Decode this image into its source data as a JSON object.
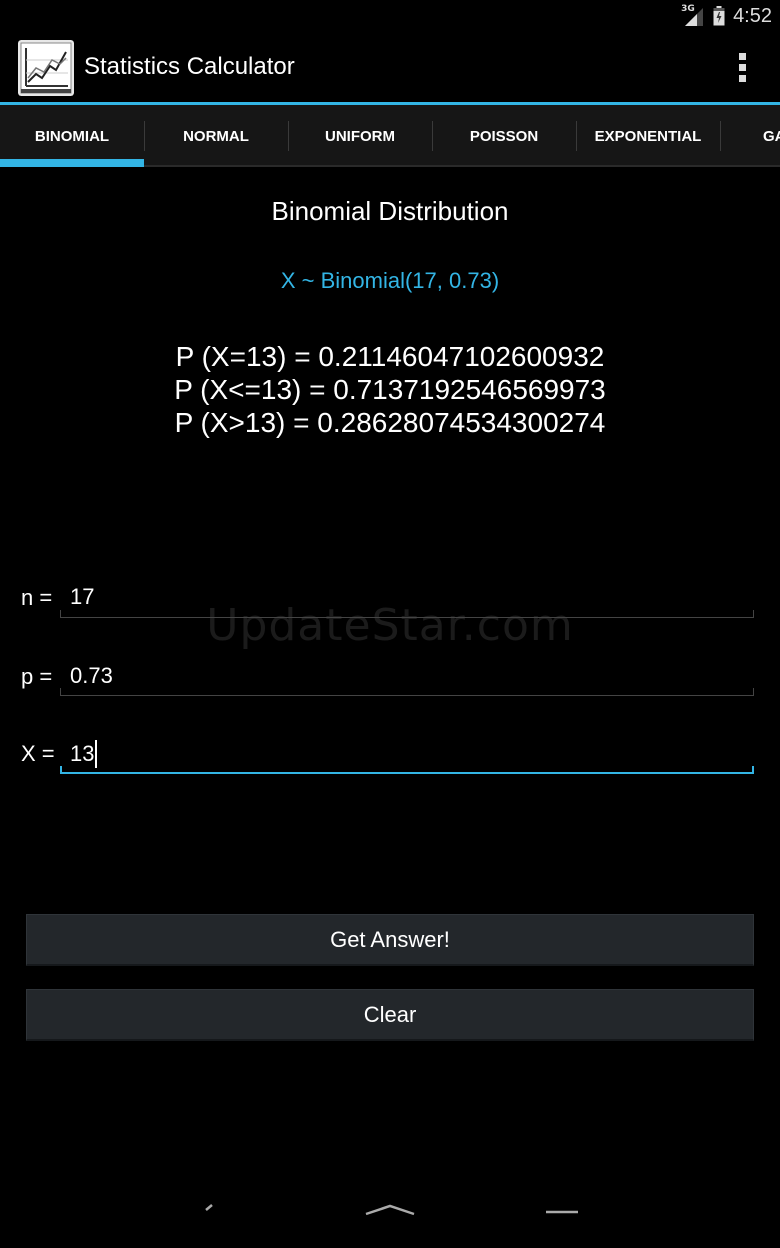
{
  "status_bar": {
    "network": "3G",
    "time": "4:52",
    "icons": [
      "signal-icon",
      "battery-icon"
    ]
  },
  "action_bar": {
    "app_icon": "chart-icon",
    "title": "Statistics Calculator",
    "overflow_icon": "overflow-menu-icon"
  },
  "tabs": [
    {
      "label": "BINOMIAL",
      "selected": true
    },
    {
      "label": "NORMAL",
      "selected": false
    },
    {
      "label": "UNIFORM",
      "selected": false
    },
    {
      "label": "POISSON",
      "selected": false
    },
    {
      "label": "EXPONENTIAL",
      "selected": false
    },
    {
      "label": "GA",
      "selected": false
    }
  ],
  "content": {
    "title": "Binomial Distribution",
    "formula": "X ~ Binomial(17, 0.73)",
    "results": [
      "P (X=13) = 0.21146047102600932",
      "P (X<=13) = 0.7137192546569973",
      "P (X>13) = 0.28628074534300274"
    ]
  },
  "fields": {
    "n": {
      "label": "n =",
      "value": "17"
    },
    "p": {
      "label": "p =",
      "value": "0.73"
    },
    "x": {
      "label": "X =",
      "value": "13"
    }
  },
  "buttons": {
    "get_answer": "Get Answer!",
    "clear": "Clear"
  },
  "watermark": "UpdateStar.com",
  "colors": {
    "accent": "#33b5e5",
    "background": "#000000",
    "button_bg": "#23272b"
  }
}
